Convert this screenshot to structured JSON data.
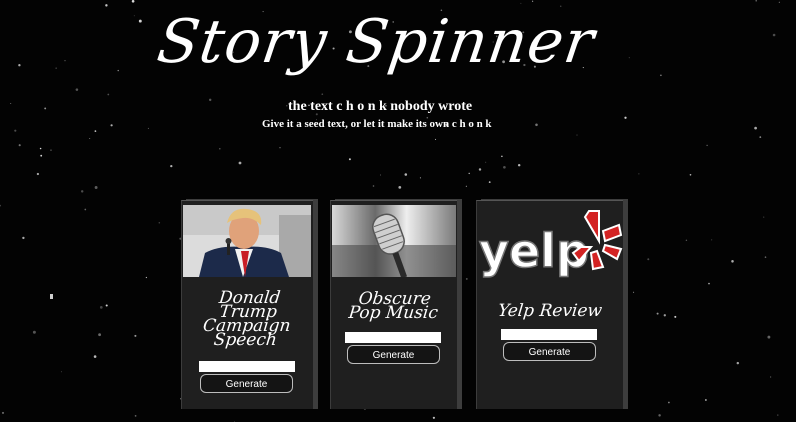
{
  "header": {
    "title": "Story Spinner",
    "subtitle": "the text c h o n k nobody wrote",
    "tagline": "Give it a seed text, or let it make its own c h o n k"
  },
  "cards": [
    {
      "title_lines": [
        "Donald",
        "Trump",
        "Campaign",
        "Speech"
      ],
      "seed_value": "",
      "button_label": "Generate",
      "image": "donald-trump-photo"
    },
    {
      "title_lines": [
        "Obscure",
        "Pop Music"
      ],
      "seed_value": "",
      "button_label": "Generate",
      "image": "vintage-microphone-photo"
    },
    {
      "title_lines": [
        "Yelp Review"
      ],
      "seed_value": "",
      "button_label": "Generate",
      "image": "yelp-logo",
      "logo_text": "yelp"
    }
  ],
  "colors": {
    "background": "#030303",
    "card": "#1f1f1f",
    "card_edge": "#3d3d3d",
    "yelp_red": "#d32323",
    "text": "#ffffff"
  }
}
